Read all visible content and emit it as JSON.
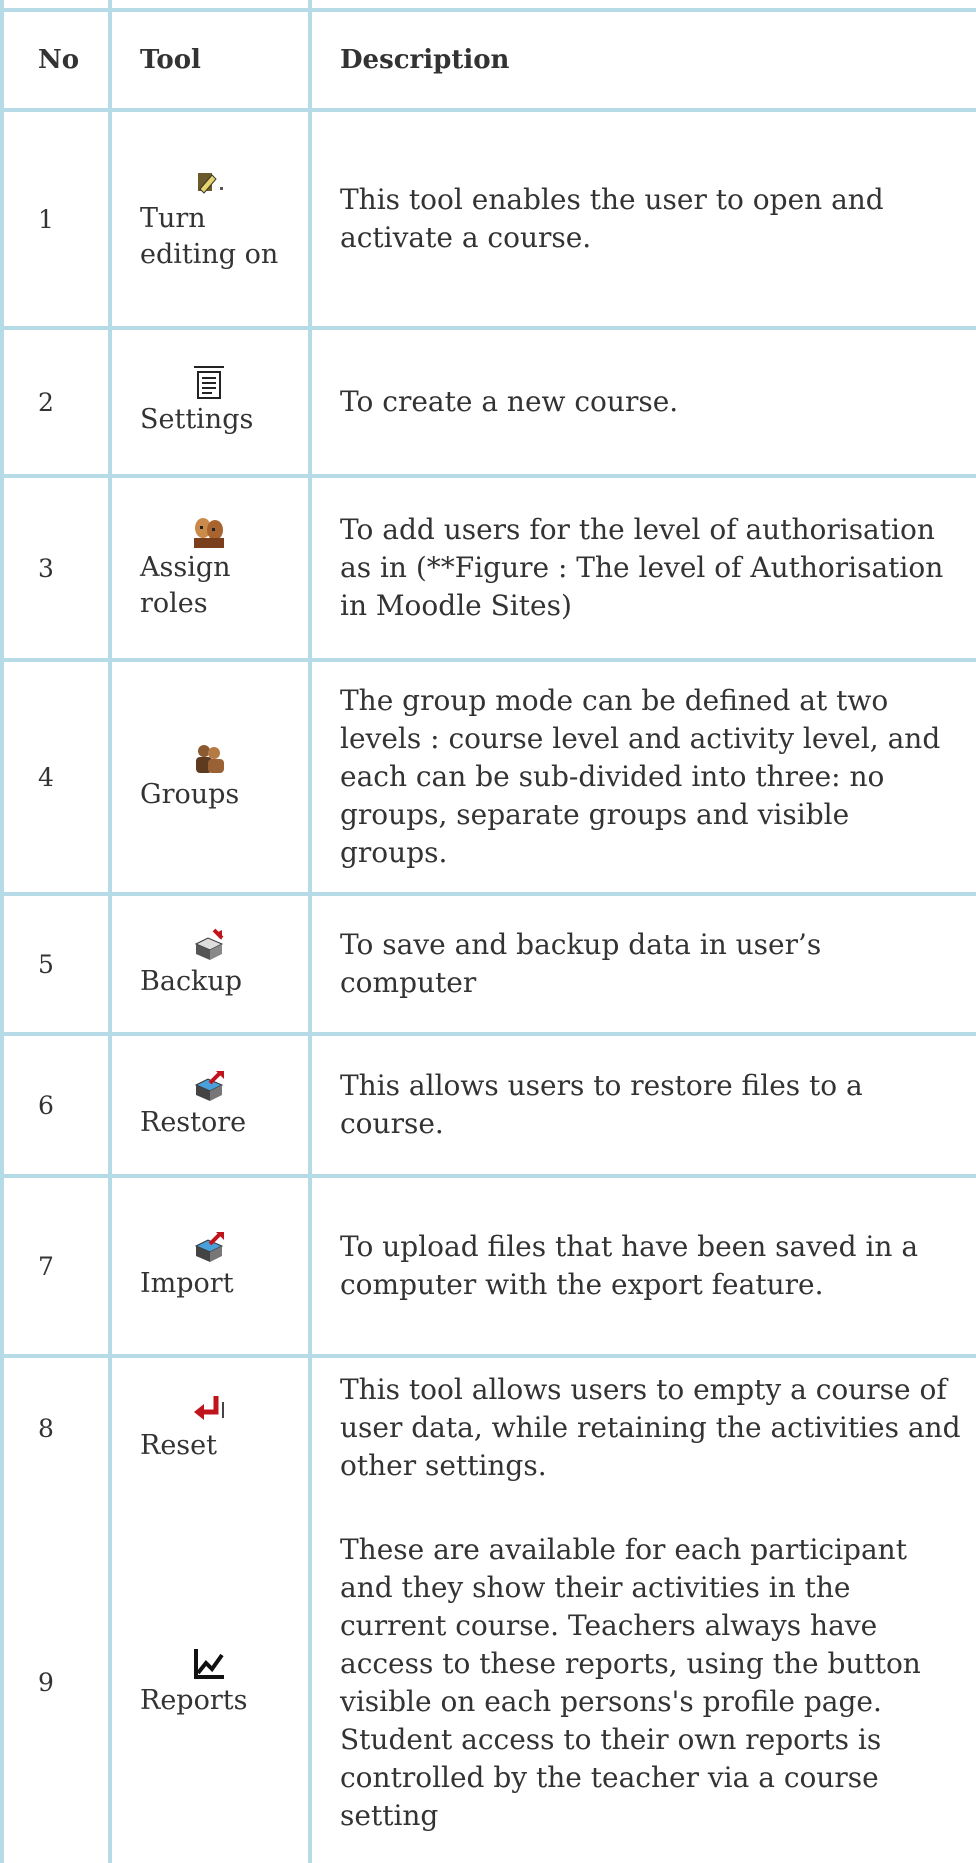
{
  "table": {
    "headers": [
      "No",
      "Tool",
      "Description"
    ],
    "rows": [
      {
        "no": "1",
        "tool": "Turn editing on",
        "icon": "turn-editing-on-icon",
        "description": "This tool enables the user to open and activate a course."
      },
      {
        "no": "2",
        "tool": "Settings",
        "icon": "settings-icon",
        "description": "To create a new course."
      },
      {
        "no": "3",
        "tool": "Assign roles",
        "icon": "assign-roles-icon",
        "description": "To add users for the level of authorisation as in (**Figure : The level of Authorisation in Moodle Sites)"
      },
      {
        "no": "4",
        "tool": "Groups",
        "icon": "groups-icon",
        "description": "The group mode can be defined at two levels : course level and activity level, and each can be sub-divided into three: no groups, separate groups and visible groups."
      },
      {
        "no": "5",
        "tool": "Backup",
        "icon": "backup-icon",
        "description": "To save and backup data in user’s computer"
      },
      {
        "no": "6",
        "tool": "Restore",
        "icon": "restore-icon",
        "description": "This allows users to restore files to a course."
      },
      {
        "no": "7",
        "tool": "Import",
        "icon": "import-icon",
        "description": "To upload files that have been saved in a computer with the export feature."
      },
      {
        "no": "8",
        "tool": "Reset",
        "icon": "reset-icon",
        "description": "This tool allows users to empty a course of user data, while retaining the activities and other settings."
      },
      {
        "no": "9",
        "tool": "Reports",
        "icon": "reports-icon",
        "description": "These are available for each participant and they show their activities in the current course. Teachers always have access to these reports, using the button visible on each persons's profile page. Student access to their own reports is controlled by the teacher via a course setting"
      }
    ]
  }
}
